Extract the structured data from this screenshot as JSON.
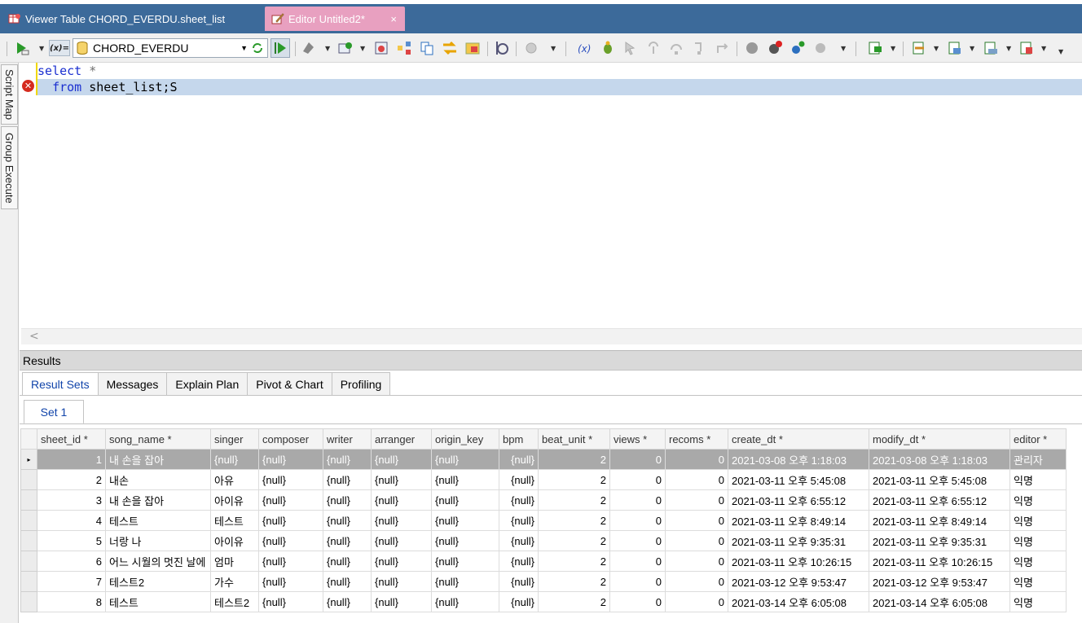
{
  "tabs": [
    {
      "label": "Viewer Table CHORD_EVERDU.sheet_list",
      "active": false
    },
    {
      "label": "Editor Untitled2*",
      "active": true,
      "close": "×"
    }
  ],
  "toolbar": {
    "var_label": "(x)=",
    "connection": "CHORD_EVERDU"
  },
  "sidebar": {
    "script_map": "Script Map",
    "group_execute": "Group Execute"
  },
  "editor": {
    "lines": [
      {
        "kw": "select",
        "rest": " *"
      },
      {
        "kw": "from",
        "rest": " sheet_list;S"
      }
    ],
    "error_line": 2,
    "scroll_left": "<"
  },
  "results": {
    "title": "Results",
    "tabs": [
      "Result Sets",
      "Messages",
      "Explain Plan",
      "Pivot & Chart",
      "Profiling"
    ],
    "active_tab": "Result Sets",
    "set_label": "Set 1",
    "columns": [
      "sheet_id *",
      "song_name *",
      "singer",
      "composer",
      "writer",
      "arranger",
      "origin_key",
      "bpm",
      "beat_unit *",
      "views *",
      "recoms *",
      "create_dt *",
      "modify_dt *",
      "editor *"
    ],
    "rows": [
      [
        "1",
        "내 손을 잡아",
        "{null}",
        "{null}",
        "{null}",
        "{null}",
        "{null}",
        "{null}",
        "2",
        "0",
        "0",
        "2021-03-08 오후 1:18:03",
        "2021-03-08 오후 1:18:03",
        "관리자"
      ],
      [
        "2",
        "내손",
        "아유",
        "{null}",
        "{null}",
        "{null}",
        "{null}",
        "{null}",
        "2",
        "0",
        "0",
        "2021-03-11 오후 5:45:08",
        "2021-03-11 오후 5:45:08",
        "익명"
      ],
      [
        "3",
        "내 손을 잡아",
        "아이유",
        "{null}",
        "{null}",
        "{null}",
        "{null}",
        "{null}",
        "2",
        "0",
        "0",
        "2021-03-11 오후 6:55:12",
        "2021-03-11 오후 6:55:12",
        "익명"
      ],
      [
        "4",
        "테스트",
        "테스트",
        "{null}",
        "{null}",
        "{null}",
        "{null}",
        "{null}",
        "2",
        "0",
        "0",
        "2021-03-11 오후 8:49:14",
        "2021-03-11 오후 8:49:14",
        "익명"
      ],
      [
        "5",
        "너랑 나",
        "아이유",
        "{null}",
        "{null}",
        "{null}",
        "{null}",
        "{null}",
        "2",
        "0",
        "0",
        "2021-03-11 오후 9:35:31",
        "2021-03-11 오후 9:35:31",
        "익명"
      ],
      [
        "6",
        "어느 시월의 멋진 날에",
        "엄마",
        "{null}",
        "{null}",
        "{null}",
        "{null}",
        "{null}",
        "2",
        "0",
        "0",
        "2021-03-11 오후 10:26:15",
        "2021-03-11 오후 10:26:15",
        "익명"
      ],
      [
        "7",
        "테스트2",
        "가수",
        "{null}",
        "{null}",
        "{null}",
        "{null}",
        "{null}",
        "2",
        "0",
        "0",
        "2021-03-12 오후 9:53:47",
        "2021-03-12 오후 9:53:47",
        "익명"
      ],
      [
        "8",
        "테스트",
        "테스트2",
        "{null}",
        "{null}",
        "{null}",
        "{null}",
        "{null}",
        "2",
        "0",
        "0",
        "2021-03-14 오후 6:05:08",
        "2021-03-14 오후 6:05:08",
        "익명"
      ]
    ],
    "selected_row": 0,
    "current_row_marker": "▸"
  },
  "colors": {
    "tabbar": "#3c6a9a",
    "active_tab": "#e8a0c0",
    "keyword": "#1a2fd0",
    "selected_row": "#a9a9a9",
    "error": "#d52b1e"
  }
}
